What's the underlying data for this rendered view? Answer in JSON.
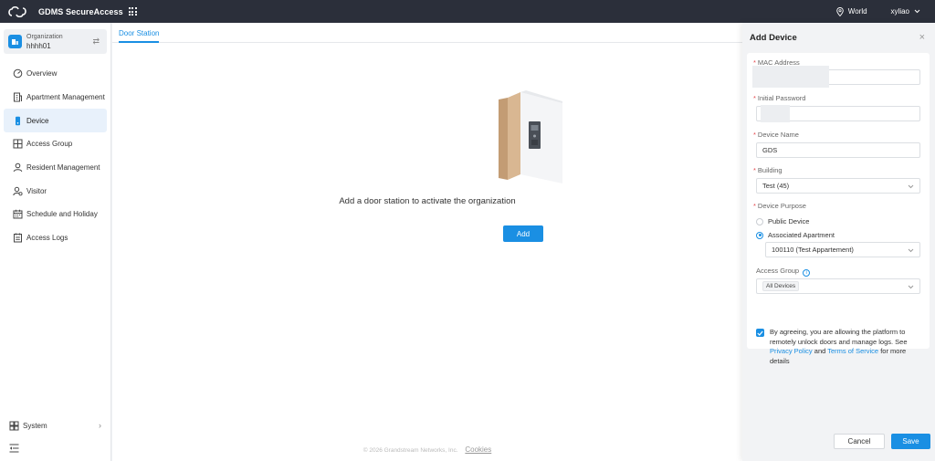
{
  "header": {
    "brand": "GDMS SecureAccess",
    "logo_icon": "cloud-link-logo",
    "apps_icon": "grid-icon",
    "region": "World",
    "region_icon": "location-pin-icon",
    "user": "xyliao",
    "user_menu_icon": "chevron-down-icon"
  },
  "sidebar": {
    "org_label": "Organization",
    "org_name": "hhhh01",
    "org_switch_icon": "swap-icon",
    "items": [
      {
        "label": "Overview",
        "icon": "dashboard-icon"
      },
      {
        "label": "Apartment Management",
        "icon": "building-icon"
      },
      {
        "label": "Device",
        "icon": "device-icon",
        "active": true
      },
      {
        "label": "Access Group",
        "icon": "access-group-icon"
      },
      {
        "label": "Resident Management",
        "icon": "user-icon"
      },
      {
        "label": "Visitor",
        "icon": "visitor-icon"
      },
      {
        "label": "Schedule and Holiday",
        "icon": "calendar-icon"
      },
      {
        "label": "Access Logs",
        "icon": "logs-icon"
      }
    ],
    "system_label": "System",
    "system_arrow": "›",
    "collapse_icon": "collapse-menu-icon"
  },
  "main": {
    "tab": "Door Station",
    "empty_message": "Add a door station to activate the organization",
    "add_label": "Add",
    "footer_text": "© 2026 Grandstream Networks, Inc.",
    "cookies_label": "Cookies"
  },
  "drawer": {
    "title": "Add Device",
    "close": "×",
    "mac_label": "MAC Address",
    "password_label": "Initial Password",
    "device_name_label": "Device Name",
    "device_name_value": "GDS",
    "building_label": "Building",
    "building_value": "Test (45)",
    "purpose_label": "Device Purpose",
    "purpose_options": [
      {
        "label": "Public Device",
        "selected": false
      },
      {
        "label": "Associated Apartment",
        "selected": true
      }
    ],
    "apartment_value": "100110 (Test Appartement)",
    "access_group_label": "Access Group",
    "access_group_info": "i",
    "access_group_tag": "All Devices",
    "agree_text": "By agreeing, you are allowing the platform to remotely unlock doors and manage logs. See",
    "privacy_link": "Privacy Policy",
    "and_text": "and",
    "terms_link": "Terms of Service",
    "more_text": "for more details",
    "agreed": true,
    "cancel_label": "Cancel",
    "save_label": "Save",
    "required_mark": "*"
  },
  "colors": {
    "accent": "#1a8fe3",
    "header_bg": "#2b2f3a",
    "required": "#e5484d"
  }
}
